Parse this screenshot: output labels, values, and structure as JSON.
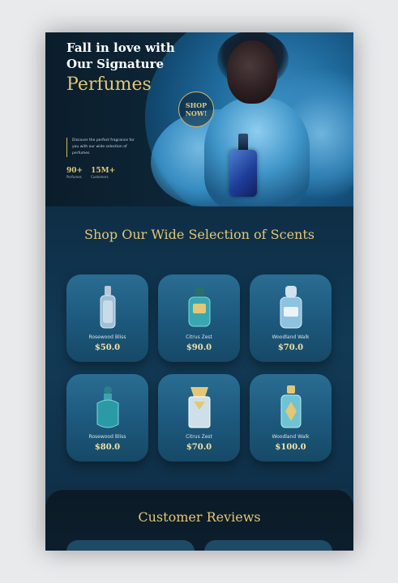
{
  "hero": {
    "title_line1": "Fall in love with",
    "title_line2": "Our Signature",
    "title_highlight": "Perfumes",
    "shop_now": "SHOP NOW!",
    "description": "Discover the perfect fragrance for you with our wide selection of perfumes",
    "stats": [
      {
        "value": "90+",
        "label": "Perfumes"
      },
      {
        "value": "15M+",
        "label": "Customers"
      }
    ]
  },
  "selection": {
    "title": "Shop Our Wide Selection of Scents",
    "products": [
      {
        "name": "Rosewood Bliss",
        "price": "$50.0",
        "icon": "perfume-bottle-icon"
      },
      {
        "name": "Citrus Zest",
        "price": "$90.0",
        "icon": "perfume-bottle-icon"
      },
      {
        "name": "Woodland Walk",
        "price": "$70.0",
        "icon": "perfume-bottle-icon"
      },
      {
        "name": "Rosewood Bliss",
        "price": "$80.0",
        "icon": "perfume-bottle-icon"
      },
      {
        "name": "Citrus Zest",
        "price": "$70.0",
        "icon": "perfume-bottle-icon"
      },
      {
        "name": "Woodland Walk",
        "price": "$100.0",
        "icon": "perfume-bottle-icon"
      }
    ]
  },
  "reviews": {
    "title": "Customer Reviews"
  },
  "colors": {
    "accent_gold": "#e3c774",
    "card_blue": "#2a6d93",
    "background": "#0f3049"
  }
}
